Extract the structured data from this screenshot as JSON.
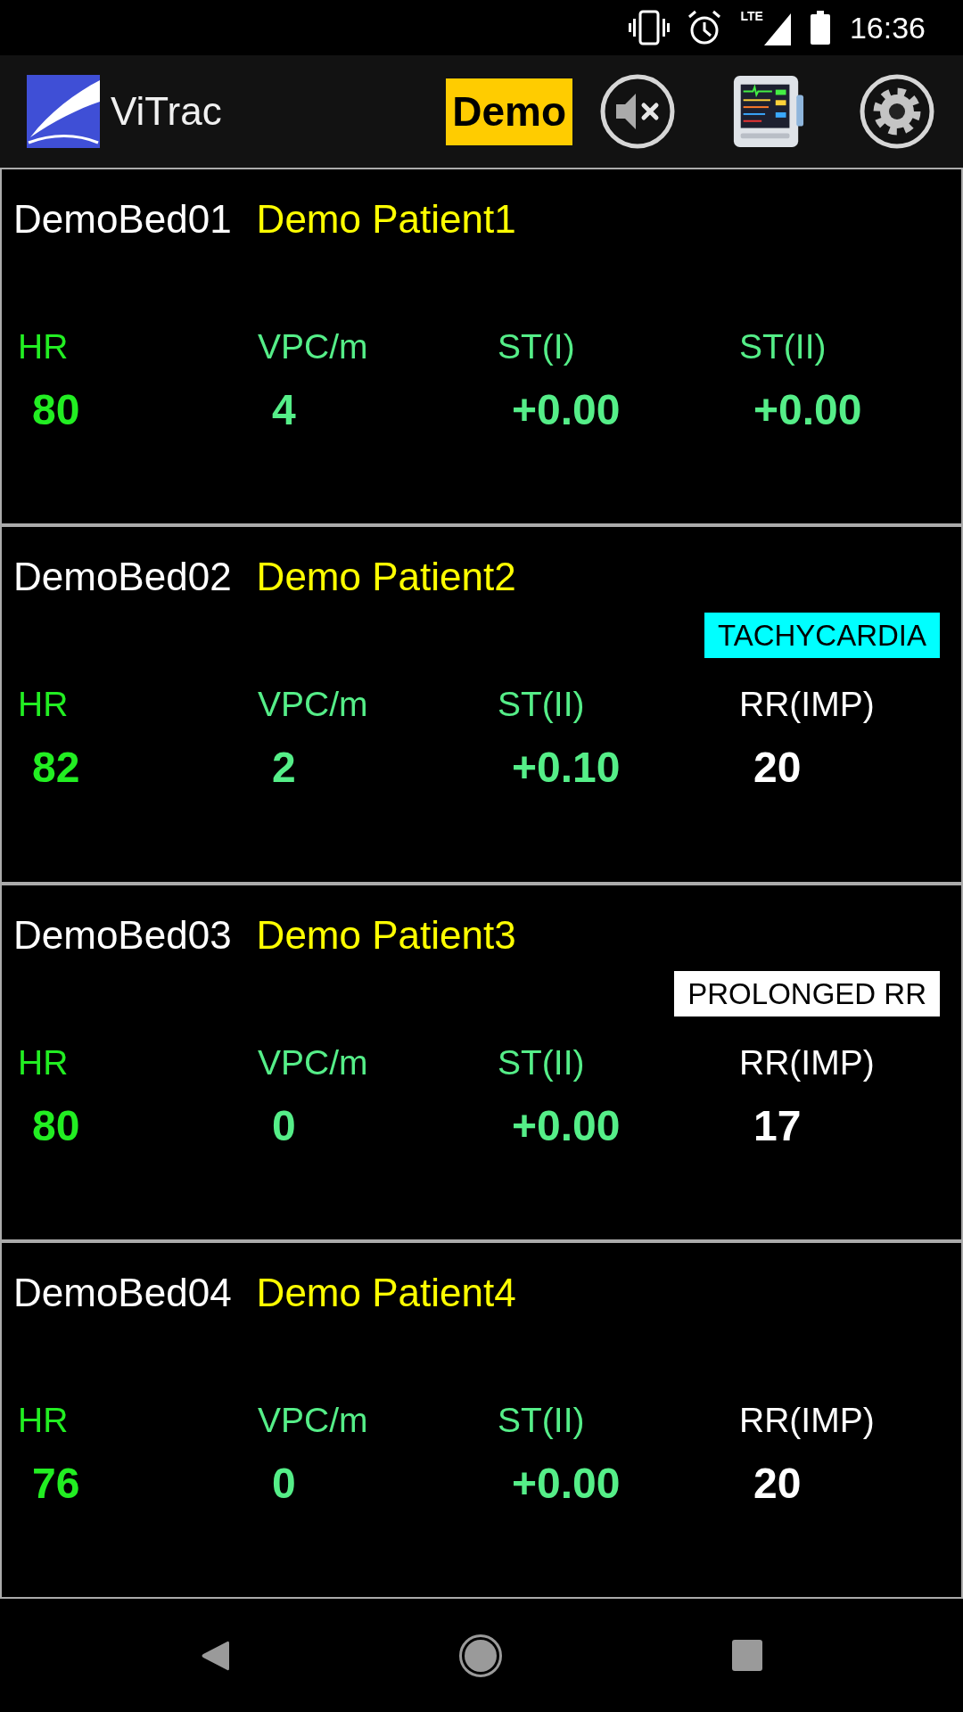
{
  "status_bar": {
    "network": "LTE",
    "time": "16:36"
  },
  "app_bar": {
    "title": "ViTrac",
    "mode_badge": "Demo"
  },
  "beds": [
    {
      "bed": "DemoBed01",
      "patient": "Demo Patient1",
      "params": [
        {
          "label": "HR",
          "value": "80",
          "color": "#22ee22"
        },
        {
          "label": "VPC/m",
          "value": "4",
          "color": "#55ee88"
        },
        {
          "label": "ST(I)",
          "value": "+0.00",
          "color": "#55ee88"
        },
        {
          "label": "ST(II)",
          "value": "+0.00",
          "color": "#55ee88"
        }
      ]
    },
    {
      "bed": "DemoBed02",
      "patient": "Demo Patient2",
      "alert": {
        "text": "TACHYCARDIA",
        "color": "#00ffff"
      },
      "params": [
        {
          "label": "HR",
          "value": "82",
          "color": "#22ee22"
        },
        {
          "label": "VPC/m",
          "value": "2",
          "color": "#55ee88"
        },
        {
          "label": "ST(II)",
          "value": "+0.10",
          "color": "#55ee88"
        },
        {
          "label": "RR(IMP)",
          "value": "20",
          "color": "#ffffff"
        }
      ]
    },
    {
      "bed": "DemoBed03",
      "patient": "Demo Patient3",
      "alert": {
        "text": "PROLONGED RR",
        "color": "#ffffff"
      },
      "params": [
        {
          "label": "HR",
          "value": "80",
          "color": "#22ee22"
        },
        {
          "label": "VPC/m",
          "value": "0",
          "color": "#55ee88"
        },
        {
          "label": "ST(II)",
          "value": "+0.00",
          "color": "#55ee88"
        },
        {
          "label": "RR(IMP)",
          "value": "17",
          "color": "#ffffff"
        }
      ]
    },
    {
      "bed": "DemoBed04",
      "patient": "Demo Patient4",
      "params": [
        {
          "label": "HR",
          "value": "76",
          "color": "#22ee22"
        },
        {
          "label": "VPC/m",
          "value": "0",
          "color": "#55ee88"
        },
        {
          "label": "ST(II)",
          "value": "+0.00",
          "color": "#55ee88"
        },
        {
          "label": "RR(IMP)",
          "value": "20",
          "color": "#ffffff"
        }
      ]
    }
  ]
}
